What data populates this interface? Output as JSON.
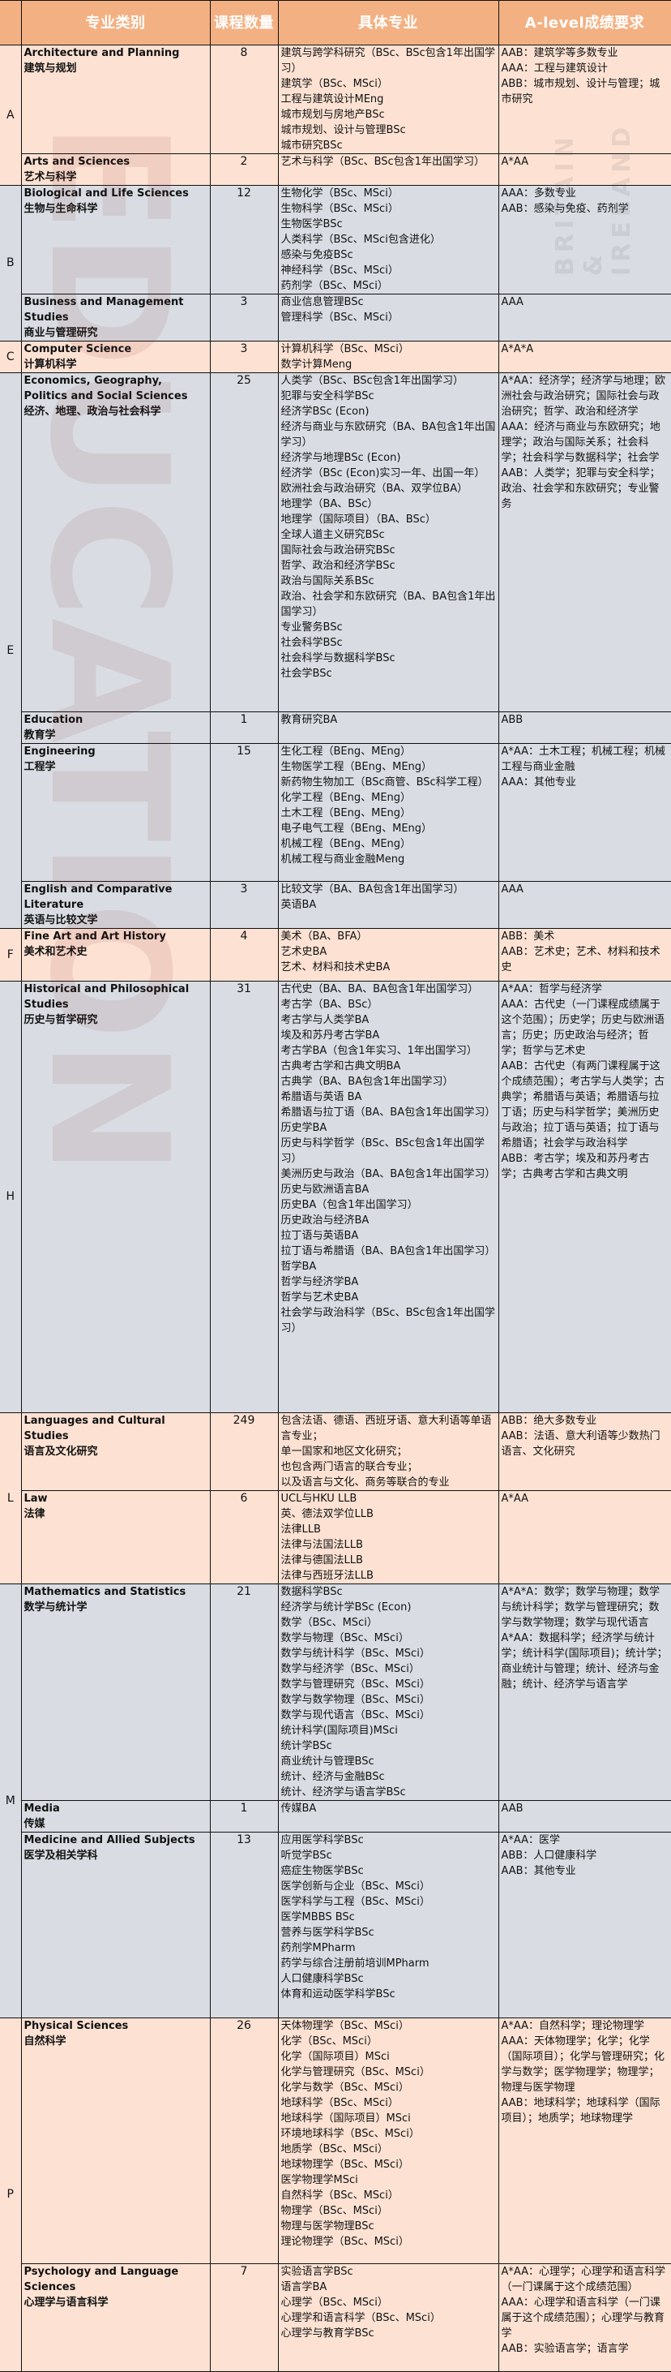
{
  "header": {
    "corner": "",
    "category": "专业类别",
    "count": "课程数量",
    "majors": "具体专业",
    "requirements": "A-level成绩要求"
  },
  "watermark": {
    "text": "EDUCATION",
    "side_text": "BRITAIN & IRELAND"
  },
  "colors": {
    "header_bg": "#f3b183",
    "row_peach": "#fde2d2",
    "row_blue": "#d6dce4",
    "border": "#111111"
  },
  "groups": [
    {
      "letter": "A",
      "rows": [
        0,
        1
      ]
    },
    {
      "letter": "B",
      "rows": [
        2,
        3
      ]
    },
    {
      "letter": "C",
      "rows": [
        4
      ]
    },
    {
      "letter": "E",
      "rows": [
        5,
        6,
        7,
        8
      ]
    },
    {
      "letter": "F",
      "rows": [
        9
      ]
    },
    {
      "letter": "H",
      "rows": [
        10
      ]
    },
    {
      "letter": "L",
      "rows": [
        11,
        12
      ]
    },
    {
      "letter": "M",
      "rows": [
        13,
        14,
        15
      ]
    },
    {
      "letter": "P",
      "rows": [
        16,
        17
      ]
    }
  ],
  "rows": [
    {
      "name_en": "Architecture and Planning",
      "name_zh": "建筑与规划",
      "count": "8",
      "majors": [
        "建筑与跨学科研究（BSc、BSc包含1年出国学习）",
        "建筑学（BSc、MSci）",
        "工程与建筑设计MEng",
        "城市规划与房地产BSc",
        "城市规划、设计与管理BSc",
        "城市研究BSc"
      ],
      "requirements": [
        "AAB：建筑学等多数专业",
        "AAA：工程与建筑设计",
        "ABB：城市规划、设计与管理；城市研究"
      ]
    },
    {
      "name_en": "Arts and Sciences",
      "name_zh": "艺术与科学",
      "count": "2",
      "majors": [
        "艺术与科学（BSc、BSc包含1年出国学习）"
      ],
      "requirements": [
        "A*AA"
      ]
    },
    {
      "name_en": "Biological and Life Sciences",
      "name_zh": "生物与生命科学",
      "count": "12",
      "majors": [
        "生物化学（BSc、MSci）",
        "生物科学（BSc、MSci）",
        "生物医学BSc",
        "人类科学（BSc、MSci包含进化）",
        "感染与免疫BSc",
        "神经科学（BSc、MSci）",
        "药剂学（BSc、MSci）"
      ],
      "requirements": [
        "AAA：多数专业",
        "AAB：感染与免疫、药剂学"
      ]
    },
    {
      "name_en": "Business and Management Studies",
      "name_zh": "商业与管理研究",
      "count": "3",
      "majors": [
        "商业信息管理BSc",
        "管理科学（BSc、MSci）"
      ],
      "requirements": [
        "AAA"
      ]
    },
    {
      "name_en": "Computer Science",
      "name_zh": "计算机科学",
      "count": "3",
      "majors": [
        "计算机科学（BSc、MSci）",
        "数学计算Meng"
      ],
      "requirements": [
        "A*A*A"
      ]
    },
    {
      "name_en": "Economics, Geography, Politics and Social Sciences",
      "name_zh": "经济、地理、政治与社会科学",
      "count": "25",
      "majors": [
        "人类学（BSc、BSc包含1年出国学习）",
        "犯罪与安全科学BSc",
        "经济学BSc (Econ)",
        "经济与商业与东欧研究（BA、BA包含1年出国学习）",
        "经济学与地理BSc (Econ)",
        "经济学（BSc (Econ)实习一年、出国一年）",
        "欧洲社会与政治研究（BA、双学位BA）",
        "地理学（BA、BSc）",
        "地理学（国际项目）（BA、BSc）",
        "全球人道主义研究BSc",
        "国际社会与政治研究BSc",
        "哲学、政治和经济学BSc",
        "政治与国际关系BSc",
        "政治、社会学和东欧研究（BA、BA包含1年出国学习）",
        "专业警务BSc",
        "社会科学BSc",
        "社会科学与数据科学BSc",
        "社会学BSc"
      ],
      "requirements": [
        "A*AA：经济学；经济学与地理；欧洲社会与政治研究；国际社会与政治研究；哲学、政治和经济学",
        "AAA：经济与商业与东欧研究；地理学；政治与国际关系；社会科学；社会科学与数据科学；社会学",
        "AAB：人类学；犯罪与安全科学；政治、社会学和东欧研究；专业警务"
      ]
    },
    {
      "name_en": "Education",
      "name_zh": "教育学",
      "count": "1",
      "majors": [
        "教育研究BA"
      ],
      "requirements": [
        "ABB"
      ]
    },
    {
      "name_en": "Engineering",
      "name_zh": "工程学",
      "count": "15",
      "majors": [
        "生化工程（BEng、MEng）",
        "生物医学工程（BEng、MEng）",
        "新药物生物加工（BSc商管、BSc科学工程）",
        "化学工程（BEng、MEng）",
        "土木工程（BEng、MEng）",
        "电子电气工程（BEng、MEng）",
        "机械工程（BEng、MEng）",
        "机械工程与商业金融Meng"
      ],
      "requirements": [
        "A*AA：土木工程；机械工程；机械工程与商业金融",
        "AAA：其他专业"
      ]
    },
    {
      "name_en": "English and Comparative Literature",
      "name_zh": "英语与比较文学",
      "count": "3",
      "majors": [
        "比较文学（BA、BA包含1年出国学习）",
        "英语BA"
      ],
      "requirements": [
        "AAA"
      ]
    },
    {
      "name_en": "Fine Art and Art History",
      "name_zh": "美术和艺术史",
      "count": "4",
      "majors": [
        "美术（BA、BFA）",
        "艺术史BA",
        "艺术、材料和技术史BA"
      ],
      "requirements": [
        "ABB：美术",
        "AAB：艺术史；艺术、材料和技术史"
      ]
    },
    {
      "name_en": "Historical and Philosophical Studies",
      "name_zh": "历史与哲学研究",
      "count": "31",
      "majors": [
        "古代史（BA、BA、BA包含1年出国学习）",
        "考古学（BA、BSc）",
        "考古学与人类学BA",
        "埃及和苏丹考古学BA",
        "考古学BA（包含1年实习、1年出国学习）",
        "古典考古学和古典文明BA",
        "古典学（BA、BA包含1年出国学习）",
        "希腊语与英语 BA",
        "希腊语与拉丁语（BA、BA包含1年出国学习）",
        "历史学BA",
        "历史与科学哲学（BSc、BSc包含1年出国学习）",
        "美洲历史与政治（BA、BA包含1年出国学习）",
        "历史与欧洲语言BA",
        "历史BA（包含1年出国学习）",
        "历史政治与经济BA",
        "拉丁语与英语BA",
        "拉丁语与希腊语（BA、BA包含1年出国学习）",
        "哲学BA",
        "哲学与经济学BA",
        "哲学与艺术史BA",
        "社会学与政治科学（BSc、BSc包含1年出国学习）"
      ],
      "requirements": [
        "A*AA：哲学与经济学",
        "AAA：古代史（一门课程成绩属于这个范围）；历史学；历史与欧洲语言；历史；历史政治与经济；哲学；哲学与艺术史",
        "AAB：古代史（有两门课程属于这个成绩范围）；考古学与人类学；古典学；希腊语与英语；希腊语与拉丁语；历史与科学哲学；美洲历史与政治；拉丁语与英语；拉丁语与希腊语；社会学与政治科学",
        "ABB：考古学；埃及和苏丹考古学；古典考古学和古典文明"
      ]
    },
    {
      "name_en": "Languages and Cultural Studies",
      "name_zh": "语言及文化研究",
      "count": "249",
      "majors": [
        "包含法语、德语、西班牙语、意大利语等单语言专业；",
        "单一国家和地区文化研究；",
        "也包含两门语言的联合专业；",
        "以及语言与文化、商务等联合的专业"
      ],
      "requirements": [
        "ABB：绝大多数专业",
        "AAB：法语、意大利语等少数热门语言、文化研究"
      ]
    },
    {
      "name_en": "Law",
      "name_zh": "法律",
      "count": "6",
      "majors": [
        "UCL与HKU LLB",
        "英、德法双学位LLB",
        "法律LLB",
        "法律与法国法LLB",
        "法律与德国法LLB",
        "法律与西班牙法LLB"
      ],
      "requirements": [
        "A*AA"
      ]
    },
    {
      "name_en": "Mathematics and Statistics",
      "name_zh": "数学与统计学",
      "count": "21",
      "majors": [
        "数据科学BSc",
        "经济学与统计学BSc (Econ)",
        "数学（BSc、MSci）",
        "数学与物理（BSc、MSci）",
        "数学与统计科学（BSc、MSci）",
        "数学与经济学（BSc、MSci）",
        "数学与管理研究（BSc、MSci）",
        "数学与数学物理（BSc、MSci）",
        "数学与现代语言（BSc、MSci）",
        "统计科学(国际项目)MSci",
        "统计学BSc",
        "商业统计与管理BSc",
        "统计、经济与金融BSc",
        "统计、经济学与语言学BSc"
      ],
      "requirements": [
        "A*A*A：数学；数学与物理；数学与统计科学；数学与管理研究；数学与数学物理；数学与现代语言",
        "A*AA：数据科学；经济学与统计学；统计科学(国际项目)；统计学；商业统计与管理；统计、经济与金融；统计、经济学与语言学"
      ]
    },
    {
      "name_en": "Media",
      "name_zh": "传媒",
      "count": "1",
      "majors": [
        "传媒BA"
      ],
      "requirements": [
        "AAB"
      ]
    },
    {
      "name_en": "Medicine and Allied Subjects",
      "name_zh": "医学及相关学科",
      "count": "13",
      "majors": [
        "应用医学科学BSc",
        "听觉学BSc",
        "癌症生物医学BSc",
        "医学创新与企业（BSc、MSci）",
        "医学科学与工程（BSc、MSci）",
        "医学MBBS BSc",
        "营养与医学科学BSc",
        "药剂学MPharm",
        "药学与综合注册前培训MPharm",
        "人口健康科学BSc",
        "体育和运动医学科学BSc"
      ],
      "requirements": [
        "A*AA：医学",
        "ABB：人口健康科学",
        "AAB：其他专业"
      ]
    },
    {
      "name_en": "Physical Sciences",
      "name_zh": "自然科学",
      "count": "26",
      "majors": [
        "天体物理学（BSc、MSci）",
        "化学（BSc、MSci）",
        "化学（国际项目）MSci",
        "化学与管理研究（BSc、MSci）",
        "化学与数学（BSc、MSci）",
        "地球科学（BSc、MSci）",
        "地球科学（国际项目）MSci",
        "环境地球科学（BSc、MSci）",
        "地质学（BSc、MSci）",
        "地球物理学（BSc、MSci）",
        "医学物理学MSci",
        "自然科学（BSc、MSci）",
        "物理学（BSc、MSci）",
        "物理与医学物理BSc",
        "理论物理学（BSc、MSci）"
      ],
      "requirements": [
        "A*AA：自然科学；理论物理学",
        "AAA：天体物理学；化学；化学（国际项目）；化学与管理研究；化学与数学；医学物理学；物理学；物理与医学物理",
        "AAB：地球科学；地球科学（国际项目）；地质学；地球物理学"
      ]
    },
    {
      "name_en": "Psychology and Language Sciences",
      "name_zh": "心理学与语言科学",
      "count": "7",
      "majors": [
        "实验语言学BSc",
        "语言学BA",
        "心理学（BSc、MSci）",
        "心理学和语言科学（BSc、MSci）",
        "心理学与教育学BSc"
      ],
      "requirements": [
        "A*AA：心理学；心理学和语言科学（一门课属于这个成绩范围）",
        "AAA：心理学和语言科学（一门课属于这个成绩范围）；心理学与教育学",
        "AAB：实验语言学；语言学"
      ]
    }
  ]
}
